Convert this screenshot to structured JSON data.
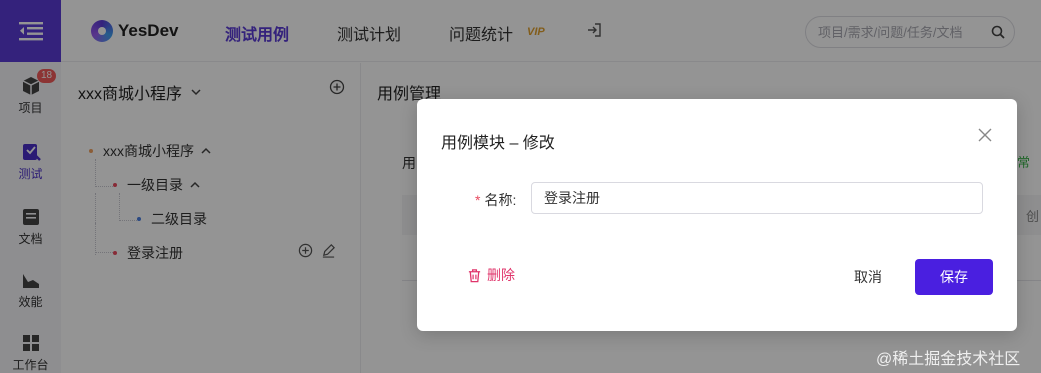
{
  "header": {
    "logo_text": "YesDev",
    "tabs": [
      {
        "label": "测试用例",
        "active": true
      },
      {
        "label": "测试计划",
        "active": false
      },
      {
        "label": "问题统计",
        "active": false
      }
    ],
    "vip_label": "VIP",
    "search_placeholder": "项目/需求/问题/任务/文档"
  },
  "rail": {
    "badge_count": "18",
    "items": [
      {
        "label": "项目",
        "icon": "cube-icon"
      },
      {
        "label": "测试",
        "icon": "test-icon"
      },
      {
        "label": "文档",
        "icon": "document-icon"
      },
      {
        "label": "效能",
        "icon": "chart-icon"
      },
      {
        "label": "工作台",
        "icon": "workbench-icon"
      }
    ]
  },
  "project_panel": {
    "title": "xxx商城小程序",
    "tree": [
      {
        "label": "xxx商城小程序",
        "color": "#f0a060"
      },
      {
        "label": "一级目录",
        "color": "#e84a5f"
      },
      {
        "label": "二级目录",
        "color": "#4a7ee0"
      },
      {
        "label": "登录注册",
        "color": "#e84a5f"
      }
    ]
  },
  "main": {
    "title": "用例管理",
    "sub_label": "用",
    "green_text": "常",
    "gray_text": "创"
  },
  "modal": {
    "title": "用例模块 – 修改",
    "name_label": "名称:",
    "required_mark": "*",
    "name_value": "登录注册",
    "delete_label": "删除",
    "cancel_label": "取消",
    "save_label": "保存"
  },
  "watermark": "@稀土掘金技术社区",
  "colors": {
    "accent": "#5b3bd6",
    "primary_button": "#4a1fe0",
    "danger": "#e0356b"
  }
}
